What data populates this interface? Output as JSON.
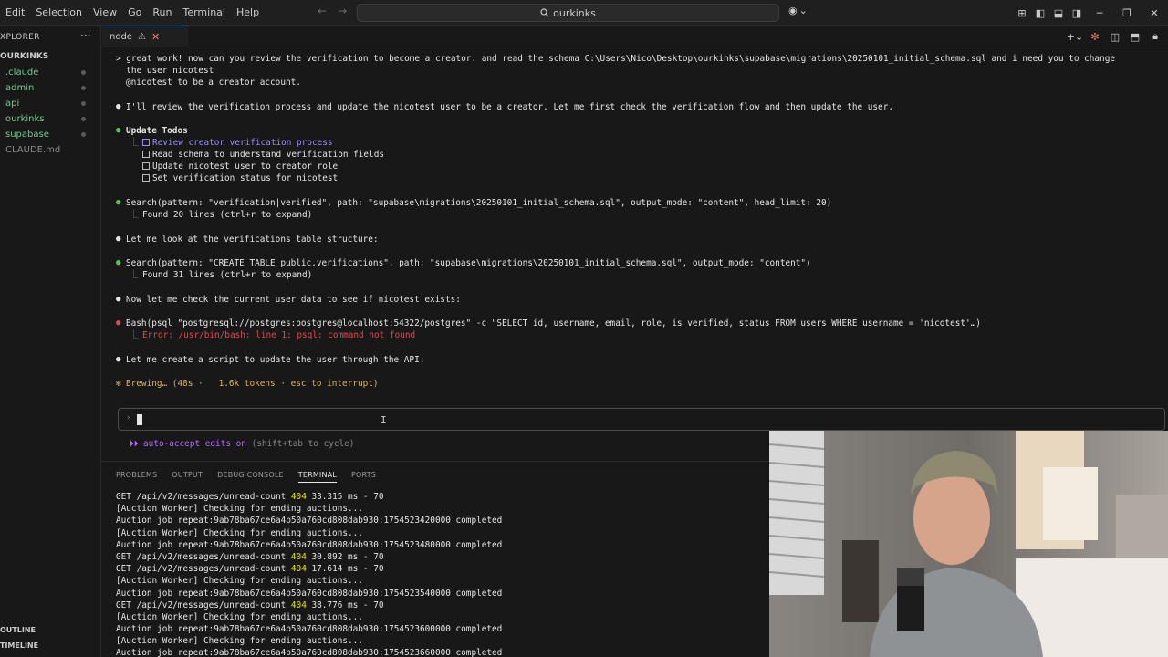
{
  "menu": [
    "Edit",
    "Selection",
    "View",
    "Go",
    "Run",
    "Terminal",
    "Help"
  ],
  "search": {
    "text": "ourkinks"
  },
  "explorer": {
    "title": "XPLORER",
    "project": "OURKINKS",
    "items": [
      {
        "label": ".claude",
        "color": "#73c991",
        "dot": true
      },
      {
        "label": "admin",
        "color": "#73c991",
        "dot": true
      },
      {
        "label": "api",
        "color": "#73c991",
        "dot": true
      },
      {
        "label": "ourkinks",
        "color": "#73c991",
        "dot": true
      },
      {
        "label": "supabase",
        "color": "#73c991",
        "dot": true
      },
      {
        "label": "CLAUDE.md",
        "color": "#8a8a8a",
        "dot": false
      }
    ],
    "outline": "OUTLINE",
    "timeline": "TIMELINE"
  },
  "tab": {
    "label": "node"
  },
  "claude": {
    "user_line1": "> great work! now can you review the verification to become a creator. and read the schema C:\\Users\\Nico\\Desktop\\ourkinks\\supabase\\migrations\\20250101_initial_schema.sql and i need you to change",
    "user_line2": "  the user nicotest",
    "user_line3": "@nicotest to be a creator account.",
    "msg1": "I'll review the verification process and update the nicotest user to be a creator. Let me first check the verification flow and then update the user.",
    "todos_title": "Update Todos",
    "todos": [
      "Review creator verification process",
      "Read schema to understand verification fields",
      "Update nicotest user to creator role",
      "Set verification status for nicotest"
    ],
    "search1": "Search(pattern: \"verification|verified\", path: \"supabase\\migrations\\20250101_initial_schema.sql\", output_mode: \"content\", head_limit: 20)",
    "search1_result": "Found 20 lines (ctrl+r to expand)",
    "msg2": "Let me look at the verifications table structure:",
    "search2": "Search(pattern: \"CREATE TABLE public.verifications\", path: \"supabase\\migrations\\20250101_initial_schema.sql\", output_mode: \"content\")",
    "search2_result": "Found 31 lines (ctrl+r to expand)",
    "msg3": "Now let me check the current user data to see if nicotest exists:",
    "bash": "Bash(psql \"postgresql://postgres:postgres@localhost:54322/postgres\" -c \"SELECT id, username, email, role, is_verified, status FROM users WHERE username = 'nicotest'…)",
    "bash_error": "Error: /usr/bin/bash: line 1: psql: command not found",
    "msg4": "Let me create a script to update the user through the API:",
    "brewing": "Brewing… (48s ·   1.6k tokens · esc to interrupt)",
    "auto_accept": "auto-accept edits on",
    "auto_accept_hint": " (shift+tab to cycle)"
  },
  "panel": {
    "tabs": [
      "PROBLEMS",
      "OUTPUT",
      "DEBUG CONSOLE",
      "TERMINAL",
      "PORTS"
    ],
    "active": "TERMINAL",
    "lines": [
      {
        "a": "GET /api/v2/messages/unread-count ",
        "y": "404",
        "b": " 33.315 ms - 70"
      },
      {
        "a": "[Auction Worker] Checking for ending auctions...",
        "y": "",
        "b": ""
      },
      {
        "a": "Auction job repeat:9ab78ba67ce6a4b50a760cd808dab930:1754523420000 completed",
        "y": "",
        "b": ""
      },
      {
        "a": "[Auction Worker] Checking for ending auctions...",
        "y": "",
        "b": ""
      },
      {
        "a": "Auction job repeat:9ab78ba67ce6a4b50a760cd808dab930:1754523480000 completed",
        "y": "",
        "b": ""
      },
      {
        "a": "GET /api/v2/messages/unread-count ",
        "y": "404",
        "b": " 30.892 ms - 70"
      },
      {
        "a": "GET /api/v2/messages/unread-count ",
        "y": "404",
        "b": " 17.614 ms - 70"
      },
      {
        "a": "[Auction Worker] Checking for ending auctions...",
        "y": "",
        "b": ""
      },
      {
        "a": "Auction job repeat:9ab78ba67ce6a4b50a760cd808dab930:1754523540000 completed",
        "y": "",
        "b": ""
      },
      {
        "a": "GET /api/v2/messages/unread-count ",
        "y": "404",
        "b": " 38.776 ms - 70"
      },
      {
        "a": "[Auction Worker] Checking for ending auctions...",
        "y": "",
        "b": ""
      },
      {
        "a": "Auction job repeat:9ab78ba67ce6a4b50a760cd808dab930:1754523600000 completed",
        "y": "",
        "b": ""
      },
      {
        "a": "[Auction Worker] Checking for ending auctions...",
        "y": "",
        "b": ""
      },
      {
        "a": "Auction job repeat:9ab78ba67ce6a4b50a760cd808dab930:1754523660000 completed",
        "y": "",
        "b": ""
      }
    ]
  },
  "colors": {
    "accent": "#0078d4",
    "claude_green": "#4ec94e",
    "error_red": "#e5484d",
    "todo_active": "#9a8cff",
    "auto_accept": "#b36bff",
    "brewing": "#e0b25a",
    "status_404": "#e5e510"
  }
}
